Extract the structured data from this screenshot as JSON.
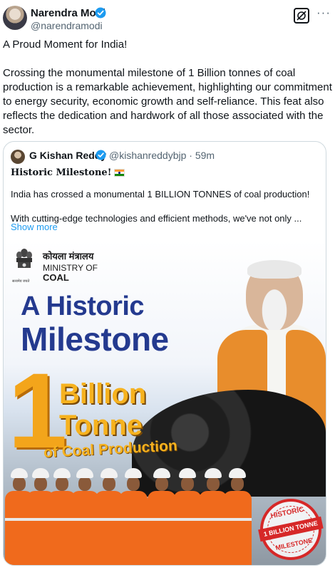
{
  "tweet": {
    "author_name": "Narendra Modi",
    "author_handle": "@narendramodi",
    "more_label": "···",
    "text": "A Proud Moment for India!\n\nCrossing the monumental milestone of 1 Billion tonnes of coal production is a remarkable achievement, highlighting our commitment to energy security, economic growth and self-reliance. This feat also reflects the dedication and hardwork of all those associated with the sector."
  },
  "quote": {
    "author_name": "G Kishan Reddy",
    "author_handle": "@kishanreddybjp · 59m",
    "title": "Historic Milestone!",
    "body": "India has crossed a monumental 1 BILLION TONNES of coal production!\n\nWith cutting-edge technologies and efficient methods, we've not only ...",
    "show_more": "Show more"
  },
  "image": {
    "ministry_hindi": "कोयला मंत्रालय",
    "ministry_of": "MINISTRY OF",
    "ministry_coal": "COAL",
    "emblem_caption": "सत्यमेव जयते",
    "headline_line1": "A Historic",
    "headline_line2": "Milestone",
    "big_number": "1",
    "billion": "Billion",
    "tonne": "Tonne",
    "coal_production": "of Coal Production",
    "stamp_top": "HISTORIC",
    "stamp_band": "1 BILLION TONNE",
    "stamp_bottom": "MILESTONE"
  },
  "colors": {
    "verified_blue": "#1d9bf0",
    "link_blue": "#1d9bf0",
    "headline_blue": "#243a8f",
    "accent_orange": "#f3a51b",
    "stamp_red": "#d62828"
  },
  "icons": {
    "verified": "verified-badge-icon",
    "grok": "grok-icon",
    "more": "more-options-icon",
    "flag": "india-flag-icon",
    "emblem": "national-emblem-icon"
  }
}
